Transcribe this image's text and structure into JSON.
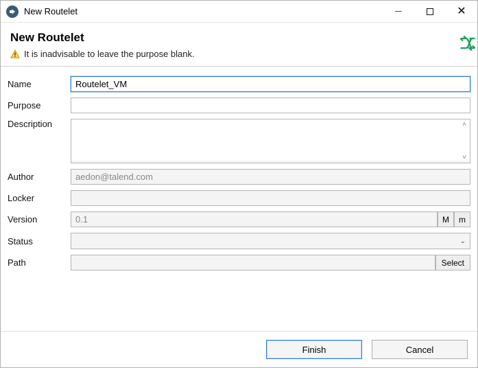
{
  "window": {
    "title": "New Routelet"
  },
  "header": {
    "heading": "New Routelet",
    "message": "It is inadvisable to leave the purpose blank."
  },
  "labels": {
    "name": "Name",
    "purpose": "Purpose",
    "description": "Description",
    "author": "Author",
    "locker": "Locker",
    "version": "Version",
    "status": "Status",
    "path": "Path"
  },
  "fields": {
    "name": "Routelet_VM",
    "purpose": "",
    "description": "",
    "author": "aedon@talend.com",
    "locker": "",
    "version": "0.1",
    "status": "",
    "path": ""
  },
  "buttons": {
    "version_major": "M",
    "version_minor": "m",
    "path_select": "Select",
    "finish": "Finish",
    "cancel": "Cancel"
  }
}
